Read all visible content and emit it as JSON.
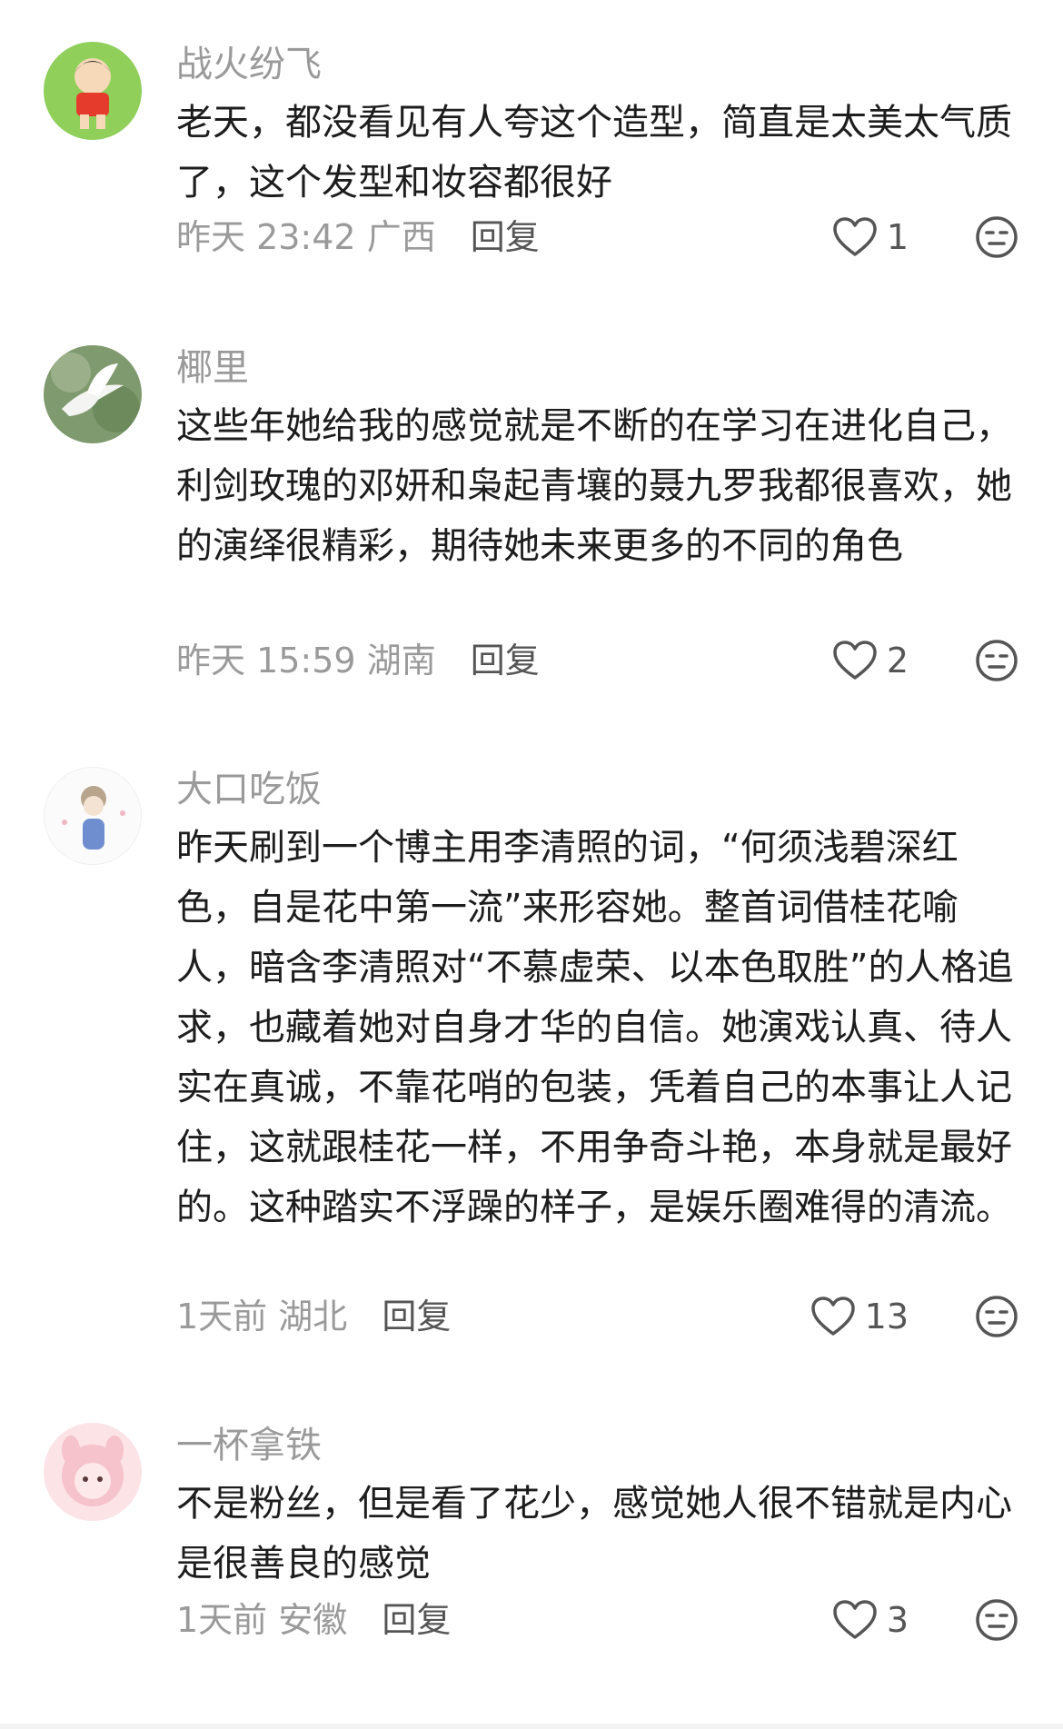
{
  "icons": {
    "like": "heart-outline-icon",
    "dislike": "neutral-face-icon"
  },
  "comments": [
    {
      "username": "战火纷飞",
      "text": "老天，都没看见有人夸这个造型，简直是太美太气质了，这个发型和妆容都很好",
      "time": "昨天 23:42",
      "location": "广西",
      "reply_label": "回复",
      "likes": "1"
    },
    {
      "username": "椰里",
      "text": "这些年她给我的感觉就是不断的在学习在进化自己，利剑玫瑰的邓妍和枭起青壤的聂九罗我都很喜欢，她的演绎很精彩，期待她未来更多的不同的角色",
      "time": "昨天 15:59",
      "location": "湖南",
      "reply_label": "回复",
      "likes": "2"
    },
    {
      "username": "大口吃饭",
      "text": "昨天刷到一个博主用李清照的词，“何须浅碧深红色，自是花中第一流”来形容她。整首词借桂花喻人，暗含李清照对“不慕虚荣、以本色取胜”的人格追求，也藏着她对自身才华的自信。她演戏认真、待人实在真诚，不靠花哨的包装，凭着自己的本事让人记住，这就跟桂花一样，不用争奇斗艳，本身就是最好的。这种踏实不浮躁的样子，是娱乐圈难得的清流。",
      "time": "1天前",
      "location": "湖北",
      "reply_label": "回复",
      "likes": "13"
    },
    {
      "username": "一杯拿铁",
      "text": "不是粉丝，但是看了花少，感觉她人很不错就是内心是很善良的感觉",
      "time": "1天前",
      "location": "安徽",
      "reply_label": "回复",
      "likes": "3"
    }
  ]
}
